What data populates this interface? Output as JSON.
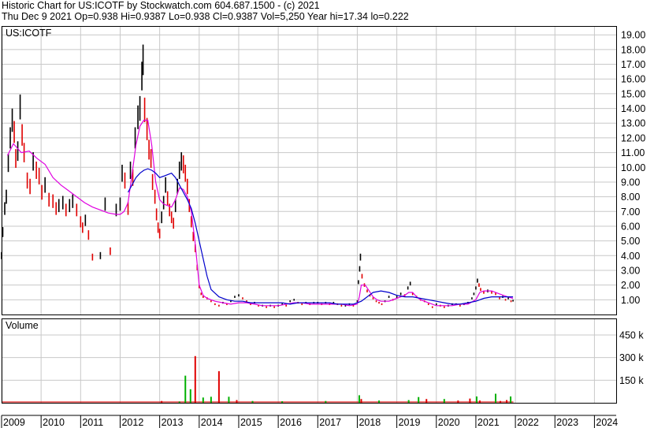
{
  "header": {
    "line1": "Historic Chart for US:ICOTF by Stockwatch.com 604.687.1500 - (c) 2021",
    "line2": "Thu Dec  9 2021  Op=0.938  Hi=0.9387  Lo=0.938  Cl=0.9387  Vol=5,250  Year hi=17.34  lo=0.222"
  },
  "colors": {
    "price_up": "#000000",
    "price_down": "#e00000",
    "ma_short": "#e000e0",
    "ma_long": "#0000cc",
    "volume_up": "#00b000",
    "volume_down": "#e00000",
    "grid": "#c8c8c8"
  },
  "chart_data": [
    {
      "type": "line",
      "title": "US:ICOTF",
      "y_ticks": [
        1,
        2,
        3,
        4,
        5,
        6,
        7,
        8,
        9,
        10,
        11,
        12,
        13,
        14,
        15,
        16,
        17,
        18,
        19
      ],
      "y_tick_labels": [
        "1.00",
        "2.00",
        "3.00",
        "4.00",
        "5.00",
        "6.00",
        "7.00",
        "8.00",
        "9.00",
        "10.00",
        "11.00",
        "12.00",
        "13.00",
        "14.00",
        "15.00",
        "16.00",
        "17.00",
        "18.00",
        "19.00"
      ],
      "ylim": [
        0,
        19.6
      ],
      "xlim": [
        2009.0,
        2024.55
      ],
      "x_tick_labels": [
        "2009",
        "2010",
        "2011",
        "2012",
        "2013",
        "2014",
        "2015",
        "2016",
        "2017",
        "2018",
        "2019",
        "2020",
        "2021",
        "2022",
        "2023",
        "2024"
      ],
      "grid": true,
      "price_points": [
        [
          2009.0,
          4.0
        ],
        [
          2009.03,
          5.6
        ],
        [
          2009.08,
          7.2
        ],
        [
          2009.12,
          8.0
        ],
        [
          2009.17,
          10.3
        ],
        [
          2009.22,
          12.0
        ],
        [
          2009.27,
          13.2
        ],
        [
          2009.32,
          12.4
        ],
        [
          2009.36,
          10.6
        ],
        [
          2009.41,
          11.1
        ],
        [
          2009.47,
          14.1
        ],
        [
          2009.52,
          12.2
        ],
        [
          2009.57,
          11.0
        ],
        [
          2009.65,
          9.1
        ],
        [
          2009.72,
          8.7
        ],
        [
          2009.8,
          10.4
        ],
        [
          2009.88,
          9.8
        ],
        [
          2009.95,
          9.4
        ],
        [
          2010.02,
          8.3
        ],
        [
          2010.1,
          8.8
        ],
        [
          2010.2,
          7.8
        ],
        [
          2010.3,
          7.7
        ],
        [
          2010.38,
          7.2
        ],
        [
          2010.45,
          7.4
        ],
        [
          2010.55,
          7.6
        ],
        [
          2010.63,
          7.1
        ],
        [
          2010.72,
          7.4
        ],
        [
          2010.8,
          7.7
        ],
        [
          2010.9,
          7.1
        ],
        [
          2011.0,
          6.3
        ],
        [
          2011.05,
          5.9
        ],
        [
          2011.12,
          6.4
        ],
        [
          2011.2,
          5.4
        ],
        [
          2011.3,
          3.9
        ],
        [
          2011.5,
          4.0
        ],
        [
          2011.62,
          7.5
        ],
        [
          2011.75,
          4.3
        ],
        [
          2011.9,
          7.1
        ],
        [
          2012.0,
          7.5
        ],
        [
          2012.05,
          9.6
        ],
        [
          2012.12,
          9.1
        ],
        [
          2012.2,
          7.2
        ],
        [
          2012.26,
          9.8
        ],
        [
          2012.32,
          9.3
        ],
        [
          2012.38,
          12.0
        ],
        [
          2012.45,
          13.4
        ],
        [
          2012.5,
          14.0
        ],
        [
          2012.55,
          16.2
        ],
        [
          2012.58,
          17.3
        ],
        [
          2012.62,
          13.9
        ],
        [
          2012.68,
          12.6
        ],
        [
          2012.73,
          11.2
        ],
        [
          2012.78,
          10.6
        ],
        [
          2012.82,
          9.0
        ],
        [
          2012.88,
          8.0
        ],
        [
          2012.92,
          6.8
        ],
        [
          2012.96,
          5.9
        ],
        [
          2013.0,
          5.5
        ],
        [
          2013.05,
          6.6
        ],
        [
          2013.1,
          7.6
        ],
        [
          2013.15,
          8.8
        ],
        [
          2013.2,
          7.9
        ],
        [
          2013.25,
          7.1
        ],
        [
          2013.3,
          6.6
        ],
        [
          2013.35,
          6.2
        ],
        [
          2013.4,
          7.4
        ],
        [
          2013.45,
          8.7
        ],
        [
          2013.5,
          9.8
        ],
        [
          2013.55,
          10.4
        ],
        [
          2013.6,
          10.2
        ],
        [
          2013.65,
          9.6
        ],
        [
          2013.7,
          8.7
        ],
        [
          2013.75,
          7.4
        ],
        [
          2013.8,
          6.3
        ],
        [
          2013.85,
          5.3
        ],
        [
          2013.9,
          4.5
        ],
        [
          2013.95,
          3.2
        ],
        [
          2014.0,
          1.9
        ],
        [
          2014.05,
          1.4
        ],
        [
          2014.1,
          1.2
        ],
        [
          2014.2,
          1.1
        ],
        [
          2014.3,
          0.9
        ],
        [
          2014.4,
          0.7
        ],
        [
          2014.5,
          0.6
        ],
        [
          2014.6,
          0.8
        ],
        [
          2014.7,
          0.7
        ],
        [
          2014.8,
          0.9
        ],
        [
          2014.9,
          1.2
        ],
        [
          2015.0,
          1.3
        ],
        [
          2015.1,
          1.1
        ],
        [
          2015.2,
          0.9
        ],
        [
          2015.3,
          0.7
        ],
        [
          2015.4,
          0.8
        ],
        [
          2015.5,
          0.6
        ],
        [
          2015.6,
          0.6
        ],
        [
          2015.7,
          0.5
        ],
        [
          2015.8,
          0.6
        ],
        [
          2015.9,
          0.5
        ],
        [
          2016.0,
          0.6
        ],
        [
          2016.1,
          0.7
        ],
        [
          2016.2,
          0.6
        ],
        [
          2016.3,
          0.9
        ],
        [
          2016.4,
          1.0
        ],
        [
          2016.5,
          0.8
        ],
        [
          2016.6,
          0.7
        ],
        [
          2016.7,
          0.8
        ],
        [
          2016.8,
          0.7
        ],
        [
          2016.9,
          0.8
        ],
        [
          2017.0,
          0.8
        ],
        [
          2017.1,
          0.7
        ],
        [
          2017.2,
          0.8
        ],
        [
          2017.3,
          0.7
        ],
        [
          2017.4,
          0.8
        ],
        [
          2017.5,
          0.7
        ],
        [
          2017.6,
          0.6
        ],
        [
          2017.7,
          0.6
        ],
        [
          2017.8,
          0.7
        ],
        [
          2017.9,
          0.6
        ],
        [
          2018.0,
          0.9
        ],
        [
          2018.03,
          2.2
        ],
        [
          2018.06,
          3.1
        ],
        [
          2018.08,
          3.9
        ],
        [
          2018.12,
          2.6
        ],
        [
          2018.18,
          2.0
        ],
        [
          2018.25,
          1.6
        ],
        [
          2018.32,
          1.3
        ],
        [
          2018.4,
          1.1
        ],
        [
          2018.48,
          0.9
        ],
        [
          2018.55,
          0.8
        ],
        [
          2018.62,
          0.7
        ],
        [
          2018.7,
          0.9
        ],
        [
          2018.8,
          1.2
        ],
        [
          2018.9,
          1.0
        ],
        [
          2019.0,
          1.2
        ],
        [
          2019.1,
          1.4
        ],
        [
          2019.2,
          1.3
        ],
        [
          2019.28,
          1.8
        ],
        [
          2019.34,
          2.1
        ],
        [
          2019.4,
          1.4
        ],
        [
          2019.5,
          1.2
        ],
        [
          2019.6,
          1.0
        ],
        [
          2019.7,
          0.9
        ],
        [
          2019.8,
          0.7
        ],
        [
          2019.9,
          0.5
        ],
        [
          2020.0,
          0.7
        ],
        [
          2020.1,
          0.6
        ],
        [
          2020.2,
          0.5
        ],
        [
          2020.3,
          0.6
        ],
        [
          2020.4,
          0.7
        ],
        [
          2020.5,
          0.7
        ],
        [
          2020.6,
          0.6
        ],
        [
          2020.7,
          0.7
        ],
        [
          2020.8,
          0.8
        ],
        [
          2020.9,
          1.1
        ],
        [
          2020.95,
          1.4
        ],
        [
          2021.0,
          1.8
        ],
        [
          2021.04,
          2.3
        ],
        [
          2021.08,
          2.0
        ],
        [
          2021.12,
          1.7
        ],
        [
          2021.2,
          1.5
        ],
        [
          2021.3,
          1.6
        ],
        [
          2021.4,
          1.5
        ],
        [
          2021.5,
          1.4
        ],
        [
          2021.6,
          1.1
        ],
        [
          2021.68,
          1.2
        ],
        [
          2021.75,
          1.0
        ],
        [
          2021.82,
          1.1
        ],
        [
          2021.89,
          0.9
        ],
        [
          2021.94,
          0.94
        ]
      ],
      "series": [
        {
          "type": "line",
          "x": [
            2009.15,
            2009.3,
            2009.5,
            2009.7,
            2009.9,
            2010.1,
            2010.3,
            2010.5,
            2010.7,
            2010.9,
            2011.1,
            2011.3,
            2011.5,
            2011.7,
            2011.9,
            2012.0,
            2012.1,
            2012.2,
            2012.3,
            2012.4,
            2012.5,
            2012.6,
            2012.7,
            2012.8,
            2012.9,
            2013.0,
            2013.1,
            2013.2,
            2013.3,
            2013.4,
            2013.5,
            2013.6,
            2013.7,
            2013.8,
            2013.9,
            2014.0,
            2014.1,
            2014.2,
            2014.4,
            2014.6,
            2014.8,
            2015.0,
            2015.2,
            2015.4,
            2015.6,
            2015.8,
            2016.0,
            2016.2,
            2016.4,
            2016.6,
            2016.8,
            2017.0,
            2017.2,
            2017.4,
            2017.6,
            2017.8,
            2018.0,
            2018.05,
            2018.1,
            2018.2,
            2018.3,
            2018.4,
            2018.5,
            2018.6,
            2018.8,
            2019.0,
            2019.2,
            2019.3,
            2019.4,
            2019.5,
            2019.6,
            2019.8,
            2020.0,
            2020.2,
            2020.4,
            2020.6,
            2020.8,
            2021.0,
            2021.1,
            2021.2,
            2021.4,
            2021.6,
            2021.8,
            2021.94
          ],
          "y": [
            10.8,
            11.6,
            11.0,
            11.1,
            10.6,
            10.2,
            9.3,
            8.8,
            8.4,
            8.0,
            7.6,
            7.3,
            7.1,
            6.9,
            6.8,
            6.8,
            7.0,
            7.6,
            9.5,
            11.5,
            12.8,
            13.2,
            13.2,
            11.5,
            9.0,
            7.8,
            7.5,
            7.4,
            7.3,
            7.8,
            8.6,
            8.5,
            8.0,
            7.0,
            4.8,
            2.0,
            1.3,
            1.1,
            0.9,
            0.8,
            0.7,
            0.8,
            0.8,
            0.7,
            0.6,
            0.6,
            0.6,
            0.7,
            0.8,
            0.8,
            0.7,
            0.7,
            0.7,
            0.7,
            0.7,
            0.6,
            0.7,
            1.2,
            2.0,
            2.0,
            1.6,
            1.2,
            1.0,
            0.9,
            0.9,
            1.1,
            1.3,
            1.5,
            1.5,
            1.2,
            1.0,
            0.8,
            0.6,
            0.6,
            0.6,
            0.7,
            0.7,
            1.0,
            1.5,
            1.6,
            1.6,
            1.4,
            1.2,
            1.1
          ]
        },
        {
          "type": "line",
          "x": [
            2012.2,
            2012.3,
            2012.4,
            2012.5,
            2012.6,
            2012.7,
            2012.8,
            2012.9,
            2013.0,
            2013.1,
            2013.2,
            2013.3,
            2013.4,
            2013.5,
            2013.6,
            2013.7,
            2013.8,
            2013.9,
            2014.0,
            2014.1,
            2014.2,
            2014.3,
            2014.5,
            2014.7,
            2014.9,
            2015.1,
            2015.3,
            2015.5,
            2015.7,
            2015.9,
            2016.1,
            2016.3,
            2016.5,
            2016.7,
            2016.9,
            2017.1,
            2017.3,
            2017.5,
            2017.7,
            2017.9,
            2018.1,
            2018.2,
            2018.3,
            2018.4,
            2018.6,
            2018.8,
            2019.0,
            2019.2,
            2019.4,
            2019.6,
            2019.8,
            2020.0,
            2020.2,
            2020.4,
            2020.6,
            2020.8,
            2021.0,
            2021.2,
            2021.4,
            2021.6,
            2021.8,
            2021.94
          ],
          "y": [
            8.3,
            8.8,
            9.3,
            9.6,
            9.8,
            9.9,
            9.8,
            9.6,
            9.3,
            9.4,
            9.5,
            9.6,
            9.3,
            8.8,
            8.3,
            7.8,
            7.2,
            6.2,
            5.0,
            3.8,
            2.6,
            1.7,
            1.2,
            1.0,
            0.9,
            0.9,
            0.8,
            0.8,
            0.8,
            0.8,
            0.8,
            0.7,
            0.8,
            0.8,
            0.8,
            0.8,
            0.8,
            0.7,
            0.7,
            0.7,
            0.9,
            1.1,
            1.3,
            1.5,
            1.6,
            1.5,
            1.3,
            1.2,
            1.2,
            1.1,
            1.0,
            0.9,
            0.8,
            0.7,
            0.7,
            0.8,
            0.9,
            1.1,
            1.2,
            1.2,
            1.2,
            1.2
          ]
        }
      ]
    },
    {
      "type": "bar",
      "title": "Volume",
      "y_ticks": [
        150000,
        300000,
        450000
      ],
      "y_tick_labels": [
        "150 k",
        "300 k",
        "450 k"
      ],
      "ylim": [
        0,
        560000
      ],
      "xlim": [
        2009.0,
        2024.55
      ],
      "grid": true,
      "spikes": [
        [
          2013.05,
          12000,
          "down"
        ],
        [
          2013.5,
          8000,
          "up"
        ],
        [
          2013.65,
          180000,
          "up"
        ],
        [
          2013.78,
          90000,
          "up"
        ],
        [
          2013.9,
          310000,
          "down"
        ],
        [
          2014.1,
          35000,
          "up"
        ],
        [
          2014.3,
          40000,
          "up"
        ],
        [
          2014.5,
          210000,
          "down"
        ],
        [
          2014.75,
          40000,
          "up"
        ],
        [
          2014.95,
          18000,
          "down"
        ],
        [
          2015.35,
          12000,
          "up"
        ],
        [
          2016.1,
          10000,
          "up"
        ],
        [
          2017.2,
          12000,
          "up"
        ],
        [
          2018.05,
          50000,
          "up"
        ],
        [
          2018.1,
          25000,
          "down"
        ],
        [
          2018.55,
          15000,
          "up"
        ],
        [
          2019.3,
          18000,
          "up"
        ],
        [
          2019.55,
          38000,
          "up"
        ],
        [
          2019.75,
          25000,
          "down"
        ],
        [
          2020.2,
          25000,
          "up"
        ],
        [
          2020.55,
          15000,
          "down"
        ],
        [
          2020.85,
          28000,
          "down"
        ],
        [
          2021.02,
          42000,
          "up"
        ],
        [
          2021.1,
          15000,
          "down"
        ],
        [
          2021.5,
          60000,
          "up"
        ],
        [
          2021.62,
          12000,
          "down"
        ],
        [
          2021.78,
          18000,
          "down"
        ],
        [
          2021.88,
          42000,
          "up"
        ]
      ]
    }
  ]
}
